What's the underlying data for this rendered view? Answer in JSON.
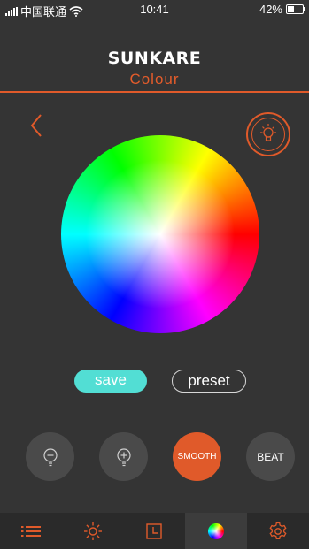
{
  "status_bar": {
    "carrier": "中国联通",
    "time": "10:41",
    "battery_percent": "42%",
    "battery_level": 0.42
  },
  "header": {
    "brand": "SUNKARE",
    "subtitle": "Colour"
  },
  "actions": {
    "save_label": "save",
    "preset_label": "preset"
  },
  "modes": {
    "smooth_label": "SMOOTH",
    "beat_label": "BEAT"
  },
  "icons": [
    "back-chevron-icon",
    "bulb-icon",
    "dim-bulb-icon",
    "bright-bulb-icon",
    "list-icon",
    "sun-icon",
    "timer-icon",
    "color-icon",
    "gear-icon"
  ],
  "colors": {
    "accent": "#e05a2a",
    "save": "#52ded4",
    "background": "#343434"
  }
}
